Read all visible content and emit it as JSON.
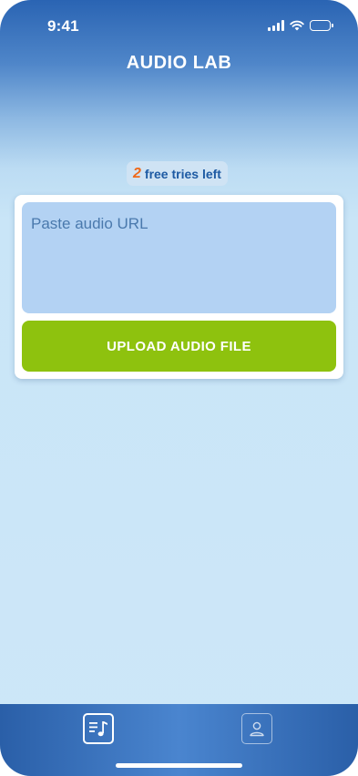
{
  "status_bar": {
    "time": "9:41"
  },
  "header": {
    "title": "AUDIO LAB"
  },
  "tries": {
    "count": "2",
    "label": "free tries left"
  },
  "form": {
    "url_placeholder": "Paste audio URL",
    "url_value": "",
    "upload_label": "UPLOAD AUDIO FILE"
  },
  "tab_bar": {
    "tabs": [
      {
        "icon": "music-list-icon",
        "active": true
      },
      {
        "icon": "person-icon",
        "active": false
      }
    ]
  },
  "colors": {
    "accent_green": "#8ec20e",
    "tries_count_orange": "#ef6a1b",
    "brand_blue": "#2a64b3"
  }
}
